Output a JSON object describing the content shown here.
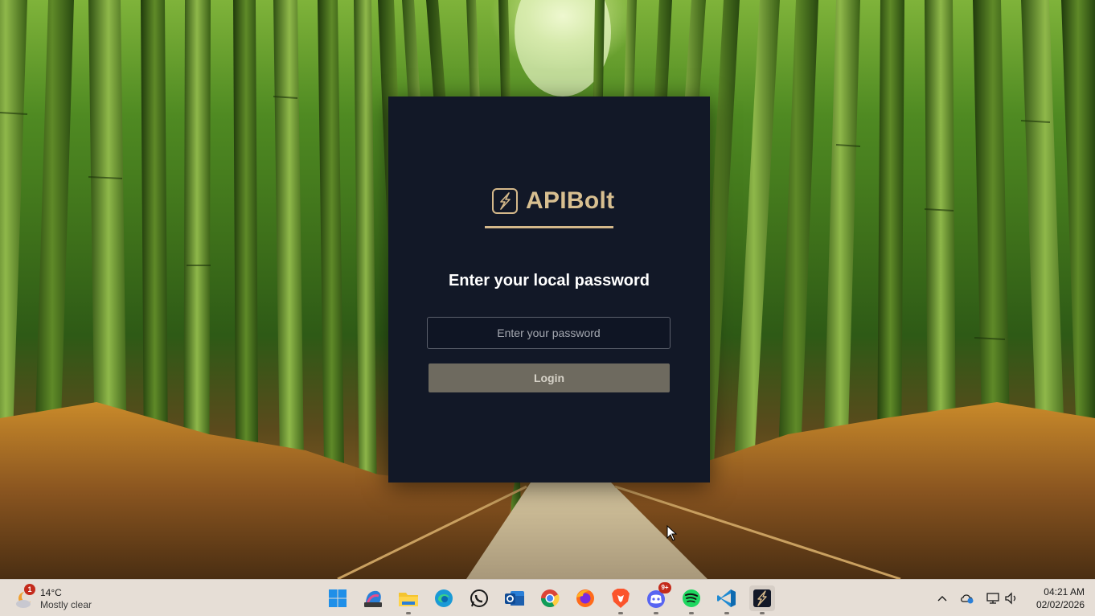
{
  "login": {
    "brand_name": "APIBolt",
    "heading": "Enter your local password",
    "password_placeholder": "Enter your password",
    "login_label": "Login"
  },
  "taskbar": {
    "weather": {
      "badge": "1",
      "temperature": "14°C",
      "description": "Mostly clear"
    },
    "apps": [
      {
        "name": "start",
        "icon": "windows-start-icon"
      },
      {
        "name": "m365",
        "icon": "microsoft-365-icon"
      },
      {
        "name": "file-explorer",
        "icon": "folder-icon",
        "running": true
      },
      {
        "name": "edge",
        "icon": "edge-browser-icon"
      },
      {
        "name": "whatsapp",
        "icon": "whatsapp-icon"
      },
      {
        "name": "outlook",
        "icon": "outlook-icon"
      },
      {
        "name": "chrome",
        "icon": "chrome-icon"
      },
      {
        "name": "firefox",
        "icon": "firefox-icon"
      },
      {
        "name": "brave",
        "icon": "brave-icon",
        "running": true
      },
      {
        "name": "discord",
        "icon": "discord-icon",
        "badge": "9+",
        "running": true
      },
      {
        "name": "spotify",
        "icon": "spotify-icon",
        "running": true
      },
      {
        "name": "vscode",
        "icon": "vscode-icon",
        "running": true
      },
      {
        "name": "apibolt",
        "icon": "apibolt-icon",
        "running": true
      }
    ],
    "discord_badge": "9+",
    "clock": {
      "time": "04:21 AM",
      "date": "02/02/2026"
    }
  },
  "colors": {
    "dialog_bg": "#121827",
    "accent_gold": "#d4b88a",
    "login_button": "#6e6a5f",
    "taskbar_bg": "#e6ded6"
  }
}
